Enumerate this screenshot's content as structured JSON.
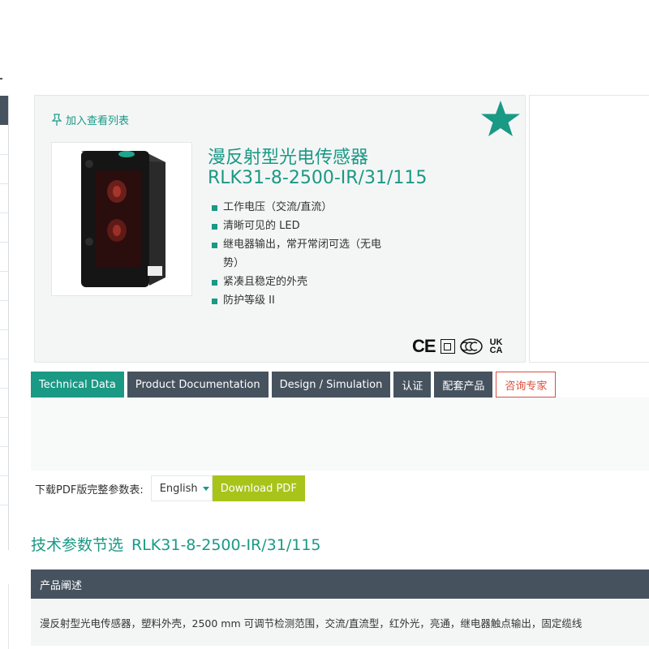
{
  "product": {
    "watchlist_label": "加入查看列表",
    "title_line1": "漫反射型光电传感器",
    "title_line2": "RLK31-8-2500-IR/31/115",
    "features": [
      "工作电压（交流/直流）",
      "清晰可见的 LED",
      "继电器输出，常开常闭可选（无电势）",
      "紧凑且稳定的外壳",
      "防护等级 II"
    ],
    "certifications": {
      "ce": "CE",
      "ukca_top": "UK",
      "ukca_bottom": "CA"
    },
    "icons": {
      "watch": "pin-icon",
      "favorite": "star-icon",
      "accent_color": "#1a9985"
    }
  },
  "tabs": [
    {
      "label": "Technical Data"
    },
    {
      "label": "Product Documentation"
    },
    {
      "label": "Design / Simulation"
    },
    {
      "label": "认证"
    },
    {
      "label": "配套产品"
    },
    {
      "label": "咨询专家"
    }
  ],
  "download": {
    "label": "下载PDF版完整参数表:",
    "language": "English",
    "button_label": "Download PDF"
  },
  "specs": {
    "section_title": "技术参数节选",
    "section_code": "RLK31-8-2500-IR/31/115",
    "description_header": "产品阐述",
    "description_text": "漫反射型光电传感器，塑料外壳，2500 mm 可调节检测范围，交流/直流型，红外光，亮通，继电器触点输出，固定缆线"
  },
  "colors": {
    "accent": "#1a9985",
    "dark": "#46535f",
    "download": "#a8c41a",
    "consult": "#d9503f"
  }
}
